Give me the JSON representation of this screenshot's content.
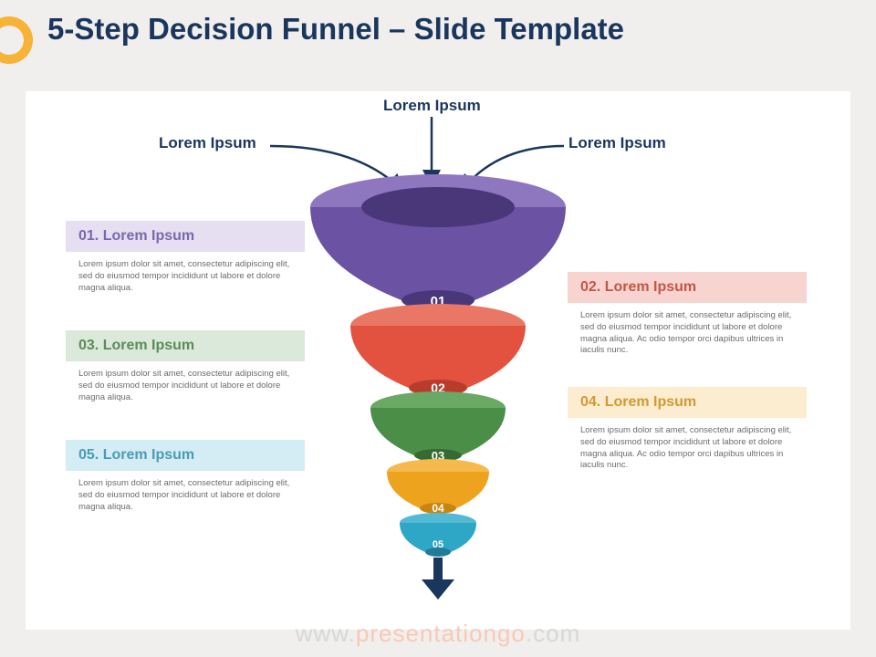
{
  "title": "5-Step Decision Funnel – Slide Template",
  "inputs": {
    "top": "Lorem Ipsum",
    "left": "Lorem Ipsum",
    "right": "Lorem Ipsum"
  },
  "steps": [
    {
      "num": "01",
      "head": "01. Lorem Ipsum",
      "body": "Lorem ipsum dolor sit amet, consectetur adipiscing elit, sed do eiusmod tempor incididunt ut labore et dolore magna aliqua.",
      "color": "#6b52a3",
      "light": "#8e77bf"
    },
    {
      "num": "02",
      "head": "02. Lorem Ipsum",
      "body": "Lorem ipsum dolor sit amet, consectetur adipiscing elit, sed do eiusmod tempor incididunt ut labore et dolore magna aliqua. Ac odio tempor orci dapibus ultrices in iaculis nunc.",
      "color": "#e2523e",
      "light": "#ea7765"
    },
    {
      "num": "03",
      "head": "03. Lorem Ipsum",
      "body": "Lorem ipsum dolor sit amet, consectetur adipiscing elit, sed do eiusmod tempor incididunt ut labore et dolore magna aliqua.",
      "color": "#4b8e48",
      "light": "#6aa865"
    },
    {
      "num": "04",
      "head": "04. Lorem Ipsum",
      "body": "Lorem ipsum dolor sit amet, consectetur adipiscing elit, sed do eiusmod tempor incididunt ut labore et dolore magna aliqua. Ac odio tempor orci dapibus ultrices in iaculis nunc.",
      "color": "#eea31e",
      "light": "#f5b94e"
    },
    {
      "num": "05",
      "head": "05. Lorem Ipsum",
      "body": "Lorem ipsum dolor sit amet, consectetur adipiscing elit, sed do eiusmod tempor incididunt ut labore et dolore magna aliqua.",
      "color": "#2ea6c6",
      "light": "#53bad4"
    }
  ],
  "watermark": {
    "prefix": "www.",
    "mid": "presentationgo",
    "suffix": ".com"
  }
}
